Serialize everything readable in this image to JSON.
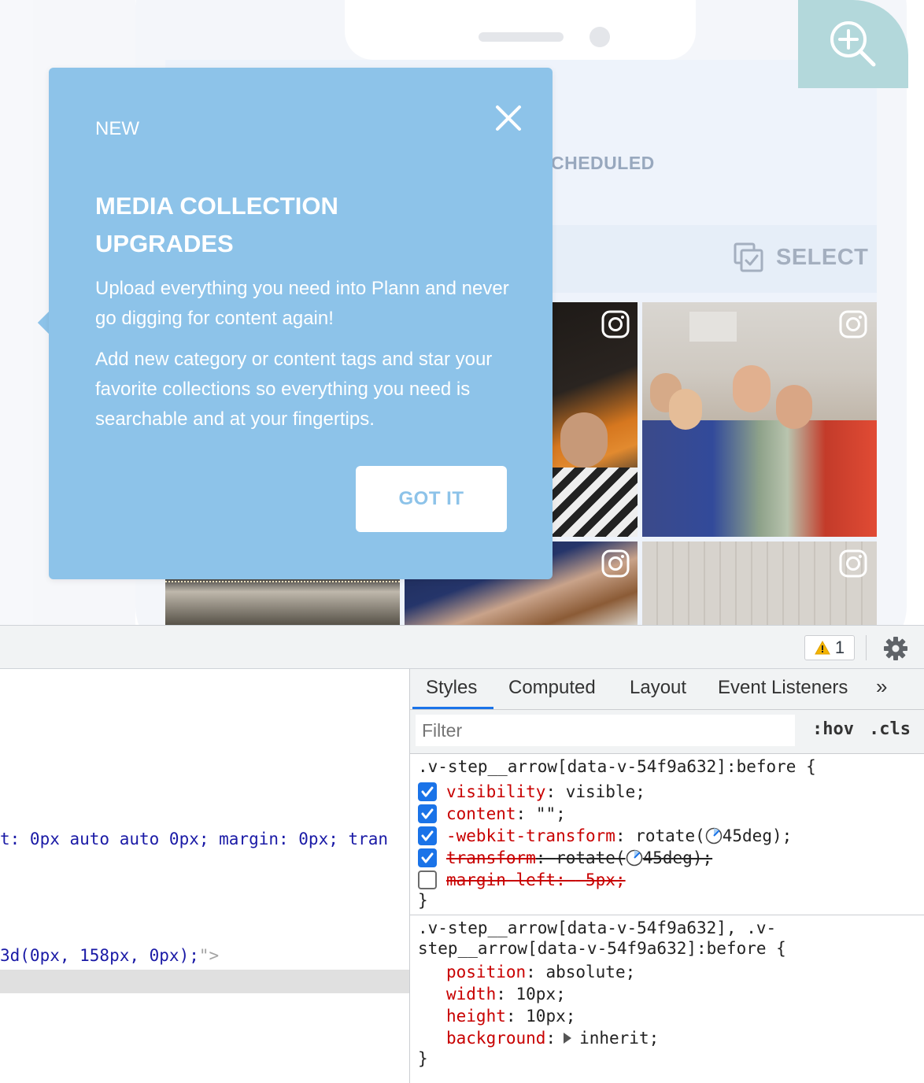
{
  "app": {
    "tab_partial": "CHEDULED",
    "select_label": "SELECT"
  },
  "tooltip": {
    "eyebrow": "NEW",
    "title": "MEDIA COLLECTION UPGRADES",
    "body1": "Upload everything you need into Plann and never go digging for content again!",
    "body2": "Add new category or content tags and star your favorite collections so everything you need is searchable and at your fingertips.",
    "button": "GOT IT"
  },
  "colors": {
    "tooltip_bg": "#8dc3e9",
    "zoom_bg": "#b3d8db",
    "devtools_accent": "#1a73e8",
    "css_property": "#c80000"
  },
  "icons": [
    "zoom-in-icon",
    "close-icon",
    "select-icon",
    "instagram-icon",
    "warning-icon",
    "gear-icon",
    "chevron-double-right-icon",
    "angle-clock-icon",
    "expand-triangle-icon"
  ],
  "devtools": {
    "warning_count": "1",
    "elements": {
      "line1": "t: 0px auto auto 0px; margin: 0px; tran",
      "line2": "3d(0px, 158px, 0px);",
      "line2_end": "\">"
    },
    "styles": {
      "tabs": [
        "Styles",
        "Computed",
        "Layout",
        "Event Listeners"
      ],
      "more": "»",
      "filter_placeholder": "Filter",
      "hov": ":hov",
      "cls": ".cls",
      "rule1": {
        "selector": ".v-step__arrow[data-v-54f9a632]:before {",
        "props": [
          {
            "name": "visibility",
            "value": "visible;",
            "checked": true,
            "struck": false
          },
          {
            "name": "content",
            "value": "\"\";",
            "checked": true,
            "struck": false
          },
          {
            "name": "-webkit-transform",
            "value_pre": "rotate(",
            "value_post": "45deg);",
            "checked": true,
            "struck": false
          },
          {
            "name": "transform",
            "value_pre": "rotate(",
            "value_post": "45deg);",
            "checked": true,
            "struck": true
          },
          {
            "name": "margin-left",
            "value": "-5px;",
            "checked": false,
            "struck": true
          }
        ],
        "close": "}"
      },
      "rule2": {
        "selector_line1": ".v-step__arrow[data-v-54f9a632], .v-",
        "selector_line2": "step__arrow[data-v-54f9a632]:before {",
        "props": [
          {
            "name": "position",
            "value": "absolute;"
          },
          {
            "name": "width",
            "value": "10px;"
          },
          {
            "name": "height",
            "value": "10px;"
          },
          {
            "name": "background",
            "value": "inherit;"
          }
        ],
        "close": "}"
      }
    }
  }
}
